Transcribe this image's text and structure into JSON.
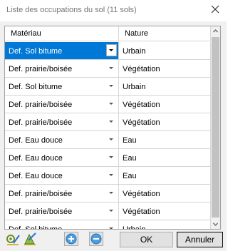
{
  "window": {
    "title": "Liste des occupations du sol (11 sols)"
  },
  "table": {
    "columns": [
      "Matériau",
      "Nature"
    ],
    "rows": [
      {
        "material": "Def. Sol bitume",
        "nature": "Urbain",
        "selected": true
      },
      {
        "material": "Def. prairie/boisée",
        "nature": "Végétation"
      },
      {
        "material": "Def. Sol bitume",
        "nature": "Urbain"
      },
      {
        "material": "Def. prairie/boisée",
        "nature": "Végétation"
      },
      {
        "material": "Def. prairie/boisée",
        "nature": "Végétation"
      },
      {
        "material": "Def. Eau douce",
        "nature": "Eau"
      },
      {
        "material": "Def. Eau douce",
        "nature": "Eau"
      },
      {
        "material": "Def. Eau douce",
        "nature": "Eau"
      },
      {
        "material": "Def. prairie/boisée",
        "nature": "Végétation"
      },
      {
        "material": "Def. prairie/boisée",
        "nature": "Végétation"
      },
      {
        "material": "Def. Sol bitume",
        "nature": "Urbain"
      }
    ]
  },
  "buttons": {
    "ok": "OK",
    "cancel": "Annuler"
  },
  "icons": {
    "left1": "terrain-tool-icon",
    "left2": "terrain-edit-icon",
    "add": "add-circle-icon",
    "remove": "remove-circle-icon"
  },
  "colors": {
    "selection": "#0078d7",
    "button_blue": "#4a9fe0"
  }
}
